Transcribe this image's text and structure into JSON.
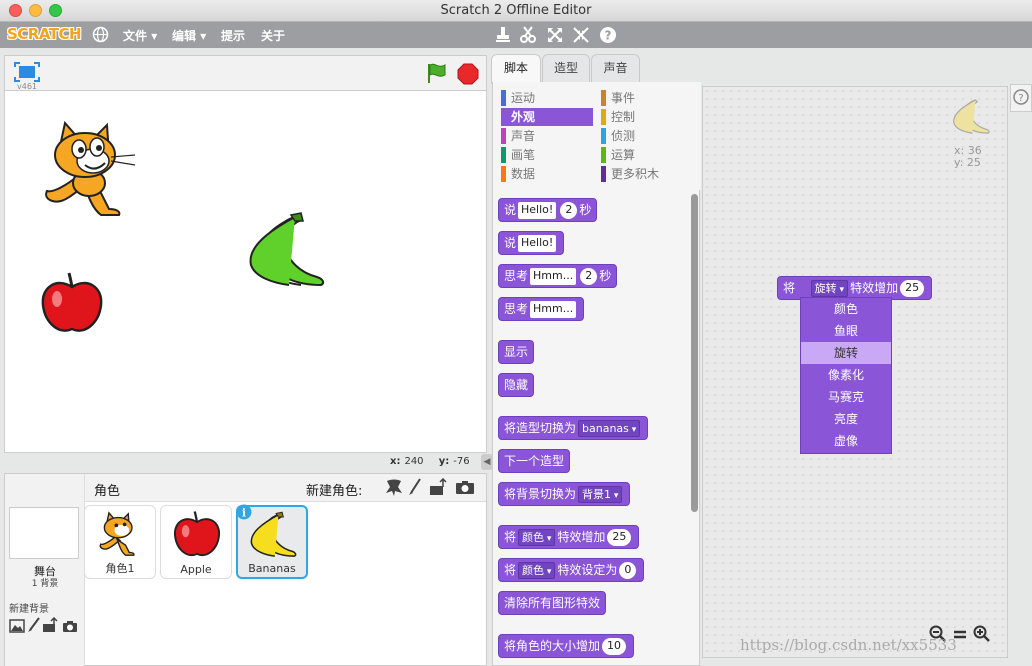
{
  "window": {
    "title": "Scratch 2 Offline Editor"
  },
  "menubar": {
    "logo": "SCRATCH",
    "items": [
      "文件",
      "编辑",
      "提示",
      "关于"
    ]
  },
  "stage": {
    "version": "v461",
    "coords": {
      "x_label": "x:",
      "x_value": "240",
      "y_label": "y:",
      "y_value": "-76"
    }
  },
  "sprites": {
    "header": "角色",
    "new_sprite_label": "新建角色:",
    "stage_label": "舞台",
    "backdrop_count": "1 背景",
    "new_backdrop_label": "新建背景",
    "items": [
      {
        "name": "角色1",
        "icon": "cat"
      },
      {
        "name": "Apple",
        "icon": "apple"
      },
      {
        "name": "Bananas",
        "icon": "bananas",
        "selected": true
      }
    ]
  },
  "tabs": [
    "脚本",
    "造型",
    "声音"
  ],
  "categories": [
    {
      "label": "运动",
      "color": "#4a6cd4"
    },
    {
      "label": "事件",
      "color": "#c88330"
    },
    {
      "label": "外观",
      "color": "#8a55d7",
      "active": true
    },
    {
      "label": "控制",
      "color": "#e1a91a"
    },
    {
      "label": "声音",
      "color": "#bb42c3"
    },
    {
      "label": "侦测",
      "color": "#2ca5e2"
    },
    {
      "label": "画笔",
      "color": "#0e9a6c"
    },
    {
      "label": "运算",
      "color": "#5cb712"
    },
    {
      "label": "数据",
      "color": "#ee7d16"
    },
    {
      "label": "更多积木",
      "color": "#632d99"
    }
  ],
  "blocks": {
    "say_for": {
      "label": "说",
      "text": "Hello!",
      "num": "2",
      "unit": "秒"
    },
    "say": {
      "label": "说",
      "text": "Hello!"
    },
    "think_for": {
      "label": "思考",
      "text": "Hmm...",
      "num": "2",
      "unit": "秒"
    },
    "think": {
      "label": "思考",
      "text": "Hmm..."
    },
    "show": "显示",
    "hide": "隐藏",
    "switch_costume": {
      "label": "将造型切换为",
      "value": "bananas"
    },
    "next_costume": "下一个造型",
    "switch_backdrop": {
      "label": "将背景切换为",
      "value": "背景1"
    },
    "change_effect": {
      "label": "将",
      "effect": "颜色",
      "suffix": "特效增加",
      "num": "25"
    },
    "set_effect": {
      "label": "将",
      "effect": "颜色",
      "suffix": "特效设定为",
      "num": "0"
    },
    "clear_effects": "清除所有图形特效",
    "change_size": {
      "label": "将角色的大小增加",
      "num": "10"
    }
  },
  "scripts": {
    "sprite_x": "x: 36",
    "sprite_y": "y: 25",
    "block": {
      "label": "将",
      "effect": "旋转",
      "suffix": "特效增加",
      "num": "25"
    },
    "dropdown": [
      "颜色",
      "鱼眼",
      "旋转",
      "像素化",
      "马赛克",
      "亮度",
      "虚像"
    ],
    "dropdown_highlight": "旋转"
  },
  "watermark": "https://blog.csdn.net/xx5533"
}
